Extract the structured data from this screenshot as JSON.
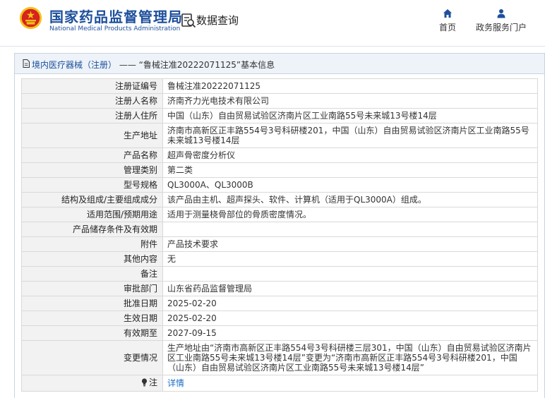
{
  "header": {
    "org_name_cn": "国家药品监督管理局",
    "org_name_en": "National Medical Products Administration",
    "query_label": "数据查询",
    "nav": [
      {
        "label": "首页",
        "icon": "home-icon"
      },
      {
        "label": "政务服务门户",
        "icon": "user-icon"
      }
    ]
  },
  "breadcrumb": {
    "prefix": "境内医疗器械（注册）",
    "separator": " —— ",
    "record": "“鲁械注准20222071125”",
    "suffix": "基本信息"
  },
  "fields": [
    {
      "key": "注册证编号",
      "value": "鲁械注准20222071125"
    },
    {
      "key": "注册人名称",
      "value": "济南齐力光电技术有限公司"
    },
    {
      "key": "注册人住所",
      "value": "中国（山东）自由贸易试验区济南片区工业南路55号未来城13号楼14层"
    },
    {
      "key": "生产地址",
      "value": "济南市高新区正丰路554号3号科研楼201，中国（山东）自由贸易试验区济南片区工业南路55号未来城13号楼14层"
    },
    {
      "key": "产品名称",
      "value": "超声骨密度分析仪"
    },
    {
      "key": "管理类别",
      "value": "第二类"
    },
    {
      "key": "型号规格",
      "value": "QL3000A、QL3000B"
    },
    {
      "key": "结构及组成/主要组成成分",
      "value": "该产品由主机、超声探头、软件、计算机（适用于QL3000A）组成。"
    },
    {
      "key": "适用范围/预期用途",
      "value": "适用于测量桡骨部位的骨质密度情况。"
    },
    {
      "key": "产品储存条件及有效期",
      "value": ""
    },
    {
      "key": "附件",
      "value": "产品技术要求"
    },
    {
      "key": "其他内容",
      "value": "无"
    },
    {
      "key": "备注",
      "value": ""
    },
    {
      "key": "审批部门",
      "value": "山东省药品监督管理局"
    },
    {
      "key": "批准日期",
      "value": "2025-02-20"
    },
    {
      "key": "生效日期",
      "value": "2025-02-20"
    },
    {
      "key": "有效期至",
      "value": "2027-09-15"
    },
    {
      "key": "变更情况",
      "value": "生产地址由“济南市高新区正丰路554号3号科研楼三层301，中国（山东）自由贸易试验区济南片区工业南路55号未来城13号楼14层”变更为“济南市高新区正丰路554号3号科研楼201，中国（山东）自由贸易试验区济南片区工业南路55号未来城13号楼14层”"
    }
  ],
  "note": {
    "key": "注",
    "link_label": "详情",
    "icon": "lightbulb-icon"
  },
  "colors": {
    "brand_blue": "#1d4f9c",
    "link_blue": "#1b6fc9",
    "emblem_red": "#d7231e",
    "emblem_gold": "#f3c21b"
  }
}
